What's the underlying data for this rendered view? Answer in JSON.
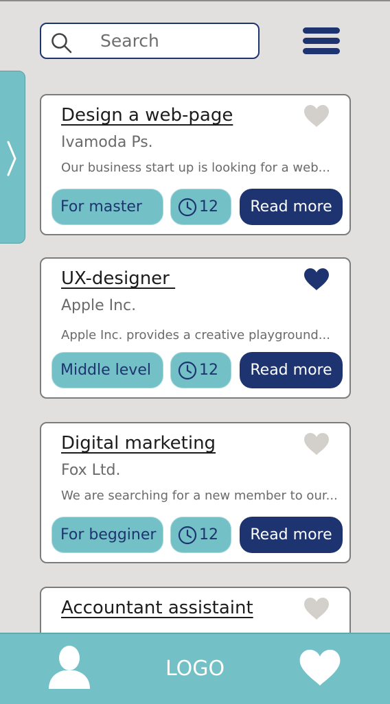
{
  "search": {
    "placeholder": "Search",
    "icon": "search-icon"
  },
  "menu": {
    "icon": "hamburger-menu-icon"
  },
  "drawer": {
    "icon": "chevron-right-icon"
  },
  "cards": [
    {
      "title": "Design a web-page",
      "company": "Ivamoda Ps.",
      "description": "Our business start up is looking for a web...",
      "level": "For master",
      "hours": "12",
      "button": "Read more",
      "favorited": false
    },
    {
      "title": "UX-designer ",
      "company": "Apple Inc.",
      "description": "Apple Inc. provides a creative playground...",
      "level": "Middle level",
      "hours": "12",
      "button": "Read more",
      "favorited": true
    },
    {
      "title": "Digital marketing",
      "company": "Fox Ltd.",
      "description": "We are searching for a new member to our...",
      "level": "For begginer",
      "hours": "12",
      "button": "Read more",
      "favorited": false
    },
    {
      "title": "Accountant assistaint",
      "favorited": false
    }
  ],
  "bottom_bar": {
    "logo": "LOGO",
    "profile_icon": "user-icon",
    "favorites_icon": "heart-icon"
  },
  "colors": {
    "background": "#e1e0df",
    "accent_teal": "#73c1c6",
    "navy": "#1e3470",
    "heart_inactive": "#d3d0cc",
    "text_muted": "#6a6a6a"
  }
}
